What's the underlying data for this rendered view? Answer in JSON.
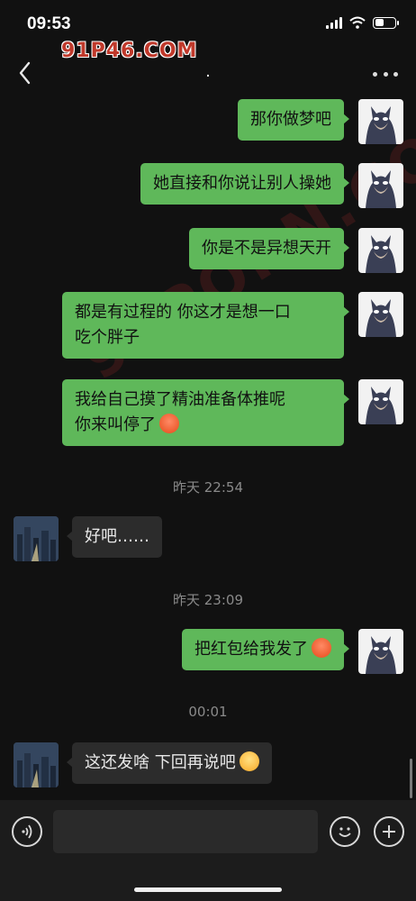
{
  "status_bar": {
    "time": "09:53"
  },
  "nav": {
    "title": ".",
    "watermark": "91P46.COM"
  },
  "watermark_diag": "91PORN.COM",
  "messages": [
    {
      "side": "me",
      "text": "那你做梦吧"
    },
    {
      "side": "me",
      "text": "她直接和你说让别人操她"
    },
    {
      "side": "me",
      "text": "你是不是异想天开"
    },
    {
      "side": "me",
      "line1": "都是有过程的 你这才是想一口",
      "line2": "吃个胖子"
    },
    {
      "side": "me",
      "line1": "我给自己摸了精油准备体推呢",
      "line2": "你来叫停了",
      "emoji": "angry-face"
    },
    {
      "timestamp": "昨天 22:54"
    },
    {
      "side": "other",
      "text": "好吧……"
    },
    {
      "timestamp": "昨天 23:09"
    },
    {
      "side": "me",
      "text": "把红包给我发了",
      "emoji": "angry-face"
    },
    {
      "timestamp": "00:01"
    },
    {
      "side": "other",
      "text": "这还发啥  下回再说吧",
      "emoji": "laughing-face"
    }
  ],
  "colors": {
    "bubble_me": "#5fb85a",
    "bubble_other": "#2c2c2c",
    "background": "#111111"
  }
}
